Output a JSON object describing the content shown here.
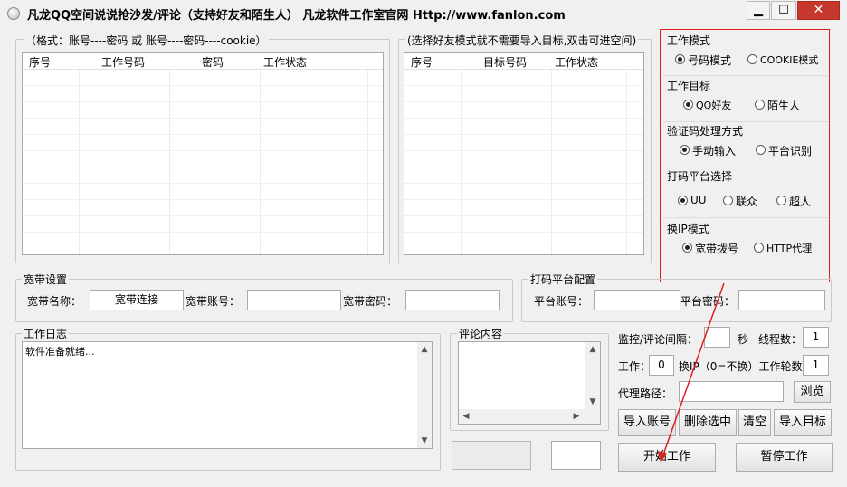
{
  "window": {
    "title": "凡龙QQ空间说说抢沙发/评论（支持好友和陌生人） 凡龙软件工作室官网  Http://www.fanlon.com",
    "minimize": "▁",
    "maximize": "☐",
    "close": "✕"
  },
  "accounts": {
    "hint": "（格式：账号----密码 或 账号----密码----cookie）",
    "columns": [
      "序号",
      "工作号码",
      "密码",
      "工作状态"
    ]
  },
  "targets": {
    "hint": "(选择好友模式就不需要导入目标,双击可进空间)",
    "columns": [
      "序号",
      "目标号码",
      "工作状态"
    ]
  },
  "settings": {
    "work_mode": {
      "title": "工作模式",
      "options": [
        "号码模式",
        "COOKIE模式"
      ],
      "selected": 0
    },
    "work_target": {
      "title": "工作目标",
      "options": [
        "QQ好友",
        "陌生人"
      ],
      "selected": 0
    },
    "captcha": {
      "title": "验证码处理方式",
      "options": [
        "手动输入",
        "平台识别"
      ],
      "selected": 0
    },
    "platform": {
      "title": "打码平台选择",
      "options": [
        "UU",
        "联众",
        "超人"
      ],
      "selected": 0
    },
    "ip_mode": {
      "title": "换IP模式",
      "options": [
        "宽带拨号",
        "HTTP代理"
      ],
      "selected": 0
    }
  },
  "broadband": {
    "title": "宽带设置",
    "name_label": "宽带名称：",
    "name_value": "宽带连接",
    "account_label": "宽带账号：",
    "account_value": "",
    "password_label": "宽带密码：",
    "password_value": ""
  },
  "captcha_platform": {
    "title": "打码平台配置",
    "account_label": "平台账号：",
    "account_value": "",
    "password_label": "平台密码：",
    "password_value": ""
  },
  "log": {
    "title": "工作日志",
    "text": "软件准备就绪..."
  },
  "comment": {
    "title": "评论内容",
    "text": ""
  },
  "controls": {
    "interval_label": "监控/评论间隔：",
    "interval_value": "",
    "sec_label": "秒",
    "threads_label": "线程数：",
    "threads_value": "1",
    "work_label": "工作：",
    "work_value": "0",
    "ip_rounds_label": "换IP（0=不换）工作轮数：",
    "ip_rounds_value": "1",
    "proxy_label": "代理路径：",
    "proxy_value": "",
    "browse": "浏览",
    "import_accounts": "导入账号",
    "delete_selected": "删除选中",
    "clear": "清空",
    "import_targets": "导入目标",
    "start": "开始工作",
    "pause": "暂停工作"
  },
  "status": {
    "box1": "",
    "box2": ""
  },
  "colors": {
    "annotation": "#e0201c"
  }
}
